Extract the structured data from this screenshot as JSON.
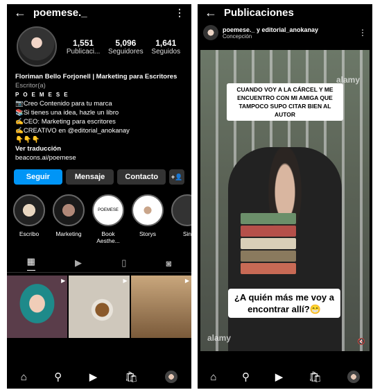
{
  "profile": {
    "username": "poemese._",
    "stats": [
      {
        "num": "1,551",
        "label": "Publicaci..."
      },
      {
        "num": "5,096",
        "label": "Seguidores"
      },
      {
        "num": "1,641",
        "label": "Seguidos"
      }
    ],
    "bio_name": "Floriman Bello Forjonell | Marketing para Escritores",
    "category": "Escritor(a)",
    "brand": "POEMESE",
    "lines": [
      "📷Creo Contenido para tu marca",
      "📚Si tienes una idea, hazle un libro",
      "✍️CEO: Marketing para escritores",
      "✍️CREATIVO en @editorial_anokanay",
      "👇👇👇"
    ],
    "translate": "Ver traducción",
    "link": "beacons.ai/poemese",
    "buttons": {
      "follow": "Seguir",
      "message": "Mensaje",
      "contact": "Contacto",
      "add": "+👤"
    },
    "highlights": [
      "Escribo",
      "Marketing",
      "Book Aesthe...",
      "Storys",
      "Sin"
    ]
  },
  "post": {
    "title": "Publicaciones",
    "author": "poemese._ y editorial_anokanay",
    "location": "Concepción",
    "caption_top": "CUANDO VOY A LA CÁRCEL Y ME ENCUENTRO CON MI AMIGA QUE TAMPOCO SUPO CITAR BIEN AL AUTOR",
    "caption_bottom": "¿A quién más me voy a encontrar allí?😁",
    "watermark": "alamy"
  },
  "icons": {
    "back": "←",
    "more": "⋮",
    "home": "⌂",
    "search": "⚲",
    "reels": "▶",
    "shop": "🛍",
    "mute": "🔇"
  }
}
